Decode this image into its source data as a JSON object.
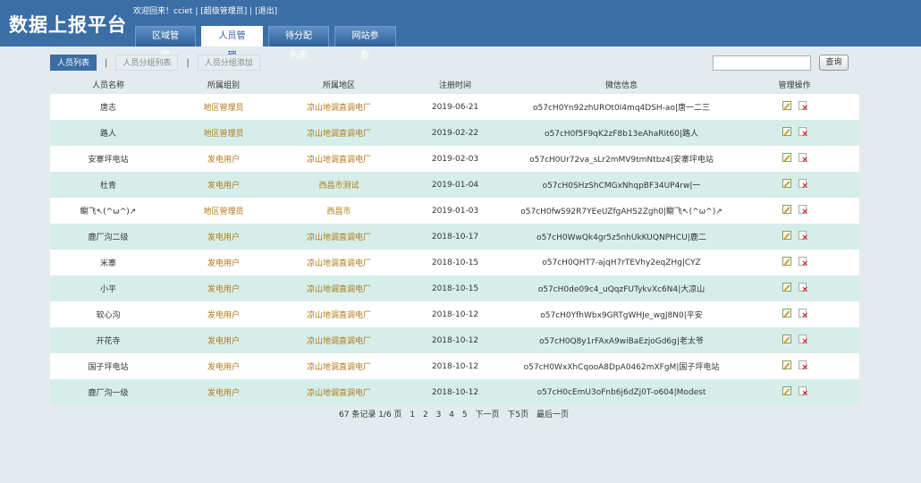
{
  "header": {
    "logo": "数据上报平台",
    "welcome": "欢迎回来！cciet",
    "sep1": "|",
    "role": "[超级管理员]",
    "sep2": "|",
    "logout": "[退出]"
  },
  "main_tabs": [
    {
      "label": "区域管理"
    },
    {
      "label": "人员管理"
    },
    {
      "label": "待分配列表"
    },
    {
      "label": "网站参数"
    }
  ],
  "sub_tabs": [
    {
      "label": "人员列表"
    },
    {
      "label": "人员分组列表"
    },
    {
      "label": "人员分组添加"
    }
  ],
  "sub_sep": "|",
  "search": {
    "placeholder": "",
    "button": "查询"
  },
  "table": {
    "headers": [
      "人员名称",
      "所属组别",
      "所属地区",
      "注册时间",
      "微信信息",
      "管理操作"
    ],
    "rows": [
      [
        "唐志",
        "地区管理员",
        "凉山地调直调电厂",
        "2019-06-21",
        "o57cH0Yn92zhUROt0I4mq4DSH-ao|唐一二三"
      ],
      [
        "路人",
        "地区管理员",
        "凉山地调直调电厂",
        "2019-02-22",
        "o57cH0f5F9qK2zF8b13eAhaRit60|路人"
      ],
      [
        "安寨坪电站",
        "发电用户",
        "凉山地调直调电厂",
        "2019-02-03",
        "o57cH0Ur72va_sLr2mMV9tmNtbz4|安寨坪电站"
      ],
      [
        "杜青",
        "发电用户",
        "西昌市测试",
        "2019-01-04",
        "o57cH0SHzShCMGxNhqpBF34UP4rw|一"
      ],
      [
        "鳚飞↖(^ω^)↗",
        "地区管理员",
        "西昌市",
        "2019-01-03",
        "o57cH0fwS92R7YEeUZfgAHS2Zgh0|鳚飞↖(^ω^)↗"
      ],
      [
        "鹿厂沟二级",
        "发电用户",
        "凉山地调直调电厂",
        "2018-10-17",
        "o57cH0WwQk4gr5z5nhUkKUQNPHCU|鹿二"
      ],
      [
        "米寨",
        "发电用户",
        "凉山地调直调电厂",
        "2018-10-15",
        "o57cH0QHT7-ajqH7rTEVhy2eqZHg|CYZ"
      ],
      [
        "小平",
        "发电用户",
        "凉山地调直调电厂",
        "2018-10-15",
        "o57cH0de09c4_uQqzFUTykvXc6N4|大凉山"
      ],
      [
        "软心沟",
        "发电用户",
        "凉山地调直调电厂",
        "2018-10-12",
        "o57cH0YfhWbx9GRTgWHJe_wgJ8N0|平安"
      ],
      [
        "开花寺",
        "发电用户",
        "凉山地调直调电厂",
        "2018-10-12",
        "o57cH0Q8y1rFAxA9wiBaEzjoGd6g|老太爷"
      ],
      [
        "国子坪电站",
        "发电用户",
        "凉山地调直调电厂",
        "2018-10-12",
        "o57cH0WxXhCqooA8DpA0462mXFgM|国子坪电站"
      ],
      [
        "鹿厂沟一级",
        "发电用户",
        "凉山地调直调电厂",
        "2018-10-12",
        "o57cH0cEmU3oFnb6j6dZj0T-o604|Modest"
      ]
    ],
    "ops": {
      "edit_icon": "edit-icon",
      "delete_icon": "delete-icon"
    }
  },
  "pager": {
    "summary": "67 条记录 1/6 页",
    "pages": [
      "1",
      "2",
      "3",
      "4",
      "5"
    ],
    "next": "下一页",
    "next5": "下5页",
    "last": "最后一页"
  }
}
